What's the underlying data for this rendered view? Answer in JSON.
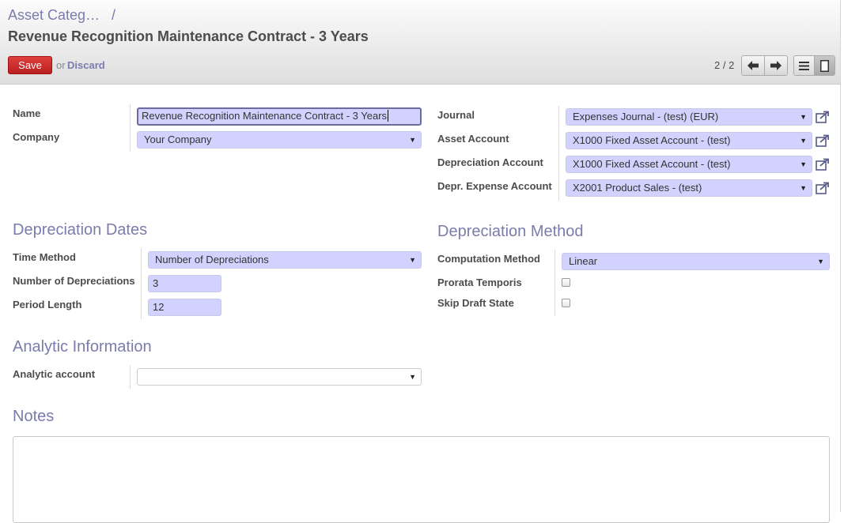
{
  "breadcrumb": {
    "parent": "Asset Categ…",
    "separator": "/"
  },
  "title": "Revenue Recognition Maintenance Contract - 3 Years",
  "toolbar": {
    "save_label": "Save",
    "or_label": "or",
    "discard_label": "Discard",
    "pager": "2 / 2"
  },
  "form": {
    "name": {
      "label": "Name",
      "value": "Revenue Recognition Maintenance Contract - 3 Years"
    },
    "company": {
      "label": "Company",
      "value": "Your Company"
    },
    "journal": {
      "label": "Journal",
      "value": "Expenses Journal - (test) (EUR)"
    },
    "asset_account": {
      "label": "Asset Account",
      "value": "X1000 Fixed Asset Account - (test)"
    },
    "depreciation_account": {
      "label": "Depreciation Account",
      "value": "X1000 Fixed Asset Account - (test)"
    },
    "expense_account": {
      "label": "Depr. Expense Account",
      "value": "X2001 Product Sales - (test)"
    }
  },
  "dates": {
    "heading": "Depreciation Dates",
    "time_method": {
      "label": "Time Method",
      "value": "Number of Depreciations"
    },
    "number": {
      "label": "Number of Depreciations",
      "value": "3"
    },
    "period": {
      "label": "Period Length",
      "value": "12"
    }
  },
  "method": {
    "heading": "Depreciation Method",
    "computation": {
      "label": "Computation Method",
      "value": "Linear"
    },
    "prorata": {
      "label": "Prorata Temporis",
      "checked": false
    },
    "skip_draft": {
      "label": "Skip Draft State",
      "checked": false
    }
  },
  "analytic": {
    "heading": "Analytic Information",
    "account": {
      "label": "Analytic account",
      "value": ""
    }
  },
  "notes": {
    "heading": "Notes",
    "value": ""
  },
  "colors": {
    "accent": "#7c7bad",
    "save": "#c8282a",
    "field": "#d2d2ff"
  }
}
